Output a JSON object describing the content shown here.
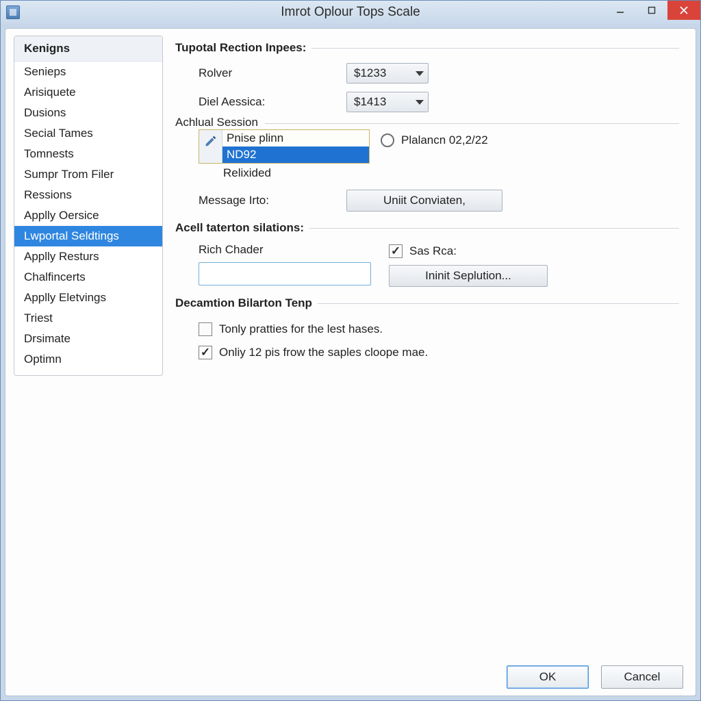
{
  "window": {
    "title": "Imrot Oplour Tops Scale"
  },
  "sidebar": {
    "header": "Kenigns",
    "selected": 8,
    "items": [
      "Senieps",
      "Arisiquete",
      "Dusions",
      "Secial Tames",
      "Tomnests",
      "Sumpr Trom Filer",
      "Ressions",
      "Applly Oersice",
      "Lwportal Seldtings",
      "Applly Resturs",
      "Chalfincerts",
      "Applly Eletvings",
      "Triest",
      "Drsimate",
      "Optimn"
    ]
  },
  "main": {
    "section1": {
      "heading": "Tupotal Rection Inpees:",
      "rolver_label": "Rolver",
      "rolver_value": "$1233",
      "diel_label": "Diel Aessica:",
      "diel_value": "$1413"
    },
    "session": {
      "legend": "Achlual Session",
      "list": {
        "item0": "Pnise plinn",
        "item1": "ND92",
        "extra_below": "Relixided"
      },
      "radio_label": "Plalancn 02,2/22",
      "message_label": "Message Irto:",
      "message_button": "Uniit Conviaten,"
    },
    "section2": {
      "heading": "Acell taterton silations:",
      "rich_label": "Rich Chader",
      "rich_value": "",
      "sas_label": "Sas Rca:",
      "sas_checked": true,
      "init_button": "Ininit Seplution..."
    },
    "section3": {
      "heading": "Decamtion Bilarton Tenp",
      "opt1_label": "Tonly pratties for the lest hases.",
      "opt1_checked": false,
      "opt2_label": "Onliy 12 pis frow the saples cloope mae.",
      "opt2_checked": true
    }
  },
  "footer": {
    "ok": "OK",
    "cancel": "Cancel"
  }
}
